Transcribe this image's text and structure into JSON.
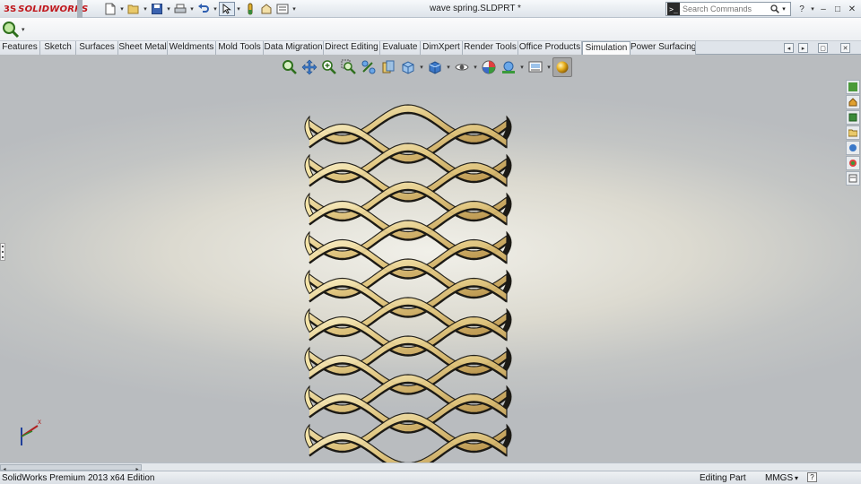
{
  "app": {
    "brand_prefix": "3S",
    "brand_name": "SOLIDWORKS",
    "document_title": "wave spring.SLDPRT *"
  },
  "search": {
    "placeholder": "Search Commands"
  },
  "quick_access": {
    "icons": [
      "new-document-icon",
      "open-icon",
      "save-icon",
      "print-icon",
      "undo-icon",
      "select-icon",
      "rebuild-icon",
      "file-properties-icon",
      "options-icon"
    ]
  },
  "window_controls": {
    "help": "?",
    "minimize": "–",
    "restore": "□",
    "close": "✕"
  },
  "command_tabs": [
    {
      "label": "Features"
    },
    {
      "label": "Sketch"
    },
    {
      "label": "Surfaces"
    },
    {
      "label": "Sheet Metal"
    },
    {
      "label": "Weldments"
    },
    {
      "label": "Mold Tools"
    },
    {
      "label": "Data Migration"
    },
    {
      "label": "Direct Editing"
    },
    {
      "label": "Evaluate"
    },
    {
      "label": "DimXpert"
    },
    {
      "label": "Render Tools"
    },
    {
      "label": "Office Products"
    },
    {
      "label": "Simulation",
      "active": true
    },
    {
      "label": "Power Surfacing"
    }
  ],
  "heads_up_toolbar": {
    "icons": [
      "zoom-to-fit-icon",
      "pan-icon",
      "zoom-in-out-icon",
      "zoom-to-area-icon",
      "previous-view-icon",
      "section-view-icon",
      "view-orientation-icon",
      "display-style-icon",
      "hide-show-items-icon",
      "edit-appearance-icon",
      "apply-scene-icon",
      "view-settings-icon",
      "realview-graphics-icon"
    ]
  },
  "model": {
    "name": "wave spring",
    "colors": {
      "light": "#f4e4a8",
      "mid": "#c8a660",
      "dark": "#1c1a15"
    }
  },
  "status_bar": {
    "edition": "SolidWorks Premium 2013 x64 Edition",
    "mode": "Editing Part",
    "units": "MMGS",
    "units_dropdown": "▾",
    "help": "?"
  }
}
